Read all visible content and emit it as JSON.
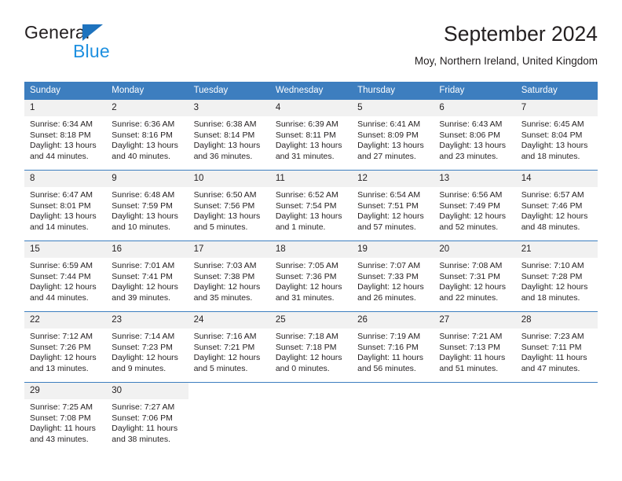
{
  "brand": {
    "name_part1": "General",
    "name_part2": "Blue",
    "triangle_icon": "triangle-logo-icon",
    "accent_color": "#1e73be",
    "blue_color": "#1e90e0"
  },
  "header": {
    "title": "September 2024",
    "subtitle": "Moy, Northern Ireland, United Kingdom"
  },
  "calendar": {
    "header_bg": "#3d7ebf",
    "daynum_bg": "#f1f1f1",
    "weekdays": [
      "Sunday",
      "Monday",
      "Tuesday",
      "Wednesday",
      "Thursday",
      "Friday",
      "Saturday"
    ],
    "weeks": [
      [
        {
          "day": "1",
          "sunrise": "Sunrise: 6:34 AM",
          "sunset": "Sunset: 8:18 PM",
          "daylight1": "Daylight: 13 hours",
          "daylight2": "and 44 minutes."
        },
        {
          "day": "2",
          "sunrise": "Sunrise: 6:36 AM",
          "sunset": "Sunset: 8:16 PM",
          "daylight1": "Daylight: 13 hours",
          "daylight2": "and 40 minutes."
        },
        {
          "day": "3",
          "sunrise": "Sunrise: 6:38 AM",
          "sunset": "Sunset: 8:14 PM",
          "daylight1": "Daylight: 13 hours",
          "daylight2": "and 36 minutes."
        },
        {
          "day": "4",
          "sunrise": "Sunrise: 6:39 AM",
          "sunset": "Sunset: 8:11 PM",
          "daylight1": "Daylight: 13 hours",
          "daylight2": "and 31 minutes."
        },
        {
          "day": "5",
          "sunrise": "Sunrise: 6:41 AM",
          "sunset": "Sunset: 8:09 PM",
          "daylight1": "Daylight: 13 hours",
          "daylight2": "and 27 minutes."
        },
        {
          "day": "6",
          "sunrise": "Sunrise: 6:43 AM",
          "sunset": "Sunset: 8:06 PM",
          "daylight1": "Daylight: 13 hours",
          "daylight2": "and 23 minutes."
        },
        {
          "day": "7",
          "sunrise": "Sunrise: 6:45 AM",
          "sunset": "Sunset: 8:04 PM",
          "daylight1": "Daylight: 13 hours",
          "daylight2": "and 18 minutes."
        }
      ],
      [
        {
          "day": "8",
          "sunrise": "Sunrise: 6:47 AM",
          "sunset": "Sunset: 8:01 PM",
          "daylight1": "Daylight: 13 hours",
          "daylight2": "and 14 minutes."
        },
        {
          "day": "9",
          "sunrise": "Sunrise: 6:48 AM",
          "sunset": "Sunset: 7:59 PM",
          "daylight1": "Daylight: 13 hours",
          "daylight2": "and 10 minutes."
        },
        {
          "day": "10",
          "sunrise": "Sunrise: 6:50 AM",
          "sunset": "Sunset: 7:56 PM",
          "daylight1": "Daylight: 13 hours",
          "daylight2": "and 5 minutes."
        },
        {
          "day": "11",
          "sunrise": "Sunrise: 6:52 AM",
          "sunset": "Sunset: 7:54 PM",
          "daylight1": "Daylight: 13 hours",
          "daylight2": "and 1 minute."
        },
        {
          "day": "12",
          "sunrise": "Sunrise: 6:54 AM",
          "sunset": "Sunset: 7:51 PM",
          "daylight1": "Daylight: 12 hours",
          "daylight2": "and 57 minutes."
        },
        {
          "day": "13",
          "sunrise": "Sunrise: 6:56 AM",
          "sunset": "Sunset: 7:49 PM",
          "daylight1": "Daylight: 12 hours",
          "daylight2": "and 52 minutes."
        },
        {
          "day": "14",
          "sunrise": "Sunrise: 6:57 AM",
          "sunset": "Sunset: 7:46 PM",
          "daylight1": "Daylight: 12 hours",
          "daylight2": "and 48 minutes."
        }
      ],
      [
        {
          "day": "15",
          "sunrise": "Sunrise: 6:59 AM",
          "sunset": "Sunset: 7:44 PM",
          "daylight1": "Daylight: 12 hours",
          "daylight2": "and 44 minutes."
        },
        {
          "day": "16",
          "sunrise": "Sunrise: 7:01 AM",
          "sunset": "Sunset: 7:41 PM",
          "daylight1": "Daylight: 12 hours",
          "daylight2": "and 39 minutes."
        },
        {
          "day": "17",
          "sunrise": "Sunrise: 7:03 AM",
          "sunset": "Sunset: 7:38 PM",
          "daylight1": "Daylight: 12 hours",
          "daylight2": "and 35 minutes."
        },
        {
          "day": "18",
          "sunrise": "Sunrise: 7:05 AM",
          "sunset": "Sunset: 7:36 PM",
          "daylight1": "Daylight: 12 hours",
          "daylight2": "and 31 minutes."
        },
        {
          "day": "19",
          "sunrise": "Sunrise: 7:07 AM",
          "sunset": "Sunset: 7:33 PM",
          "daylight1": "Daylight: 12 hours",
          "daylight2": "and 26 minutes."
        },
        {
          "day": "20",
          "sunrise": "Sunrise: 7:08 AM",
          "sunset": "Sunset: 7:31 PM",
          "daylight1": "Daylight: 12 hours",
          "daylight2": "and 22 minutes."
        },
        {
          "day": "21",
          "sunrise": "Sunrise: 7:10 AM",
          "sunset": "Sunset: 7:28 PM",
          "daylight1": "Daylight: 12 hours",
          "daylight2": "and 18 minutes."
        }
      ],
      [
        {
          "day": "22",
          "sunrise": "Sunrise: 7:12 AM",
          "sunset": "Sunset: 7:26 PM",
          "daylight1": "Daylight: 12 hours",
          "daylight2": "and 13 minutes."
        },
        {
          "day": "23",
          "sunrise": "Sunrise: 7:14 AM",
          "sunset": "Sunset: 7:23 PM",
          "daylight1": "Daylight: 12 hours",
          "daylight2": "and 9 minutes."
        },
        {
          "day": "24",
          "sunrise": "Sunrise: 7:16 AM",
          "sunset": "Sunset: 7:21 PM",
          "daylight1": "Daylight: 12 hours",
          "daylight2": "and 5 minutes."
        },
        {
          "day": "25",
          "sunrise": "Sunrise: 7:18 AM",
          "sunset": "Sunset: 7:18 PM",
          "daylight1": "Daylight: 12 hours",
          "daylight2": "and 0 minutes."
        },
        {
          "day": "26",
          "sunrise": "Sunrise: 7:19 AM",
          "sunset": "Sunset: 7:16 PM",
          "daylight1": "Daylight: 11 hours",
          "daylight2": "and 56 minutes."
        },
        {
          "day": "27",
          "sunrise": "Sunrise: 7:21 AM",
          "sunset": "Sunset: 7:13 PM",
          "daylight1": "Daylight: 11 hours",
          "daylight2": "and 51 minutes."
        },
        {
          "day": "28",
          "sunrise": "Sunrise: 7:23 AM",
          "sunset": "Sunset: 7:11 PM",
          "daylight1": "Daylight: 11 hours",
          "daylight2": "and 47 minutes."
        }
      ],
      [
        {
          "day": "29",
          "sunrise": "Sunrise: 7:25 AM",
          "sunset": "Sunset: 7:08 PM",
          "daylight1": "Daylight: 11 hours",
          "daylight2": "and 43 minutes."
        },
        {
          "day": "30",
          "sunrise": "Sunrise: 7:27 AM",
          "sunset": "Sunset: 7:06 PM",
          "daylight1": "Daylight: 11 hours",
          "daylight2": "and 38 minutes."
        },
        {
          "day": "",
          "sunrise": "",
          "sunset": "",
          "daylight1": "",
          "daylight2": ""
        },
        {
          "day": "",
          "sunrise": "",
          "sunset": "",
          "daylight1": "",
          "daylight2": ""
        },
        {
          "day": "",
          "sunrise": "",
          "sunset": "",
          "daylight1": "",
          "daylight2": ""
        },
        {
          "day": "",
          "sunrise": "",
          "sunset": "",
          "daylight1": "",
          "daylight2": ""
        },
        {
          "day": "",
          "sunrise": "",
          "sunset": "",
          "daylight1": "",
          "daylight2": ""
        }
      ]
    ]
  }
}
